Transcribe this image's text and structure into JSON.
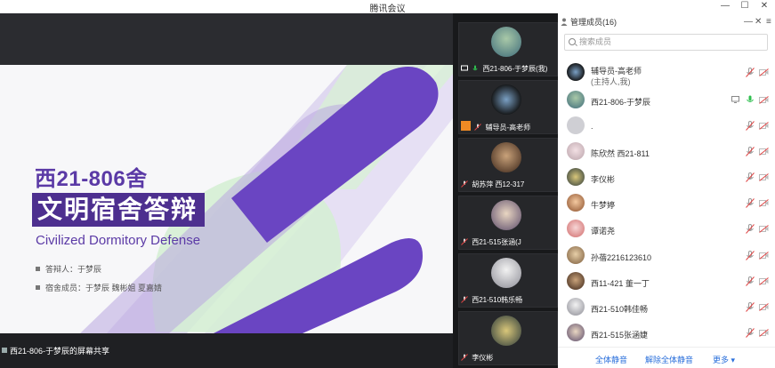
{
  "window": {
    "title": "腾讯会议",
    "min_label": "—",
    "max_label": "☐",
    "close_label": "✕"
  },
  "slide": {
    "title_line1": "西21-806舍",
    "title_line2": "文明宿舍答辩",
    "subtitle_en": "Civilized Dormitory Defense",
    "bullet1": "答辩人：于梦辰",
    "bullet2": "宿舍成员：于梦辰  魏彬姐  夏嘉婧"
  },
  "share_label": "西21-806-于梦辰的屏幕共享",
  "tiles": [
    {
      "label": "西21-806-于梦辰(我)"
    },
    {
      "label": "辅导员-高老师"
    },
    {
      "label": "胡苏萍 西12-317"
    },
    {
      "label": "西21-515张涵(J"
    },
    {
      "label": "西21-510韩乐畅"
    },
    {
      "label": "李仪彬"
    }
  ],
  "panel": {
    "title": "管理成员(16)",
    "search_placeholder": "搜索成员",
    "members": [
      {
        "name": "辅导员-高老师",
        "sub": "(主持人,我)"
      },
      {
        "name": "西21-806-于梦辰",
        "sub": ""
      },
      {
        "name": ".",
        "sub": ""
      },
      {
        "name": "陈欣然 西21-811",
        "sub": ""
      },
      {
        "name": "李仪彬",
        "sub": ""
      },
      {
        "name": "牛梦婷",
        "sub": ""
      },
      {
        "name": "谭诺尧",
        "sub": ""
      },
      {
        "name": "孙蓓2216123610",
        "sub": ""
      },
      {
        "name": "西11-421 董一丁",
        "sub": ""
      },
      {
        "name": "西21-510韩佳畅",
        "sub": ""
      },
      {
        "name": "西21-515张涵婕",
        "sub": ""
      }
    ],
    "footer": {
      "mute_all": "全体静音",
      "unmute_all": "解除全体静音",
      "more": "更多 ▾"
    }
  },
  "colors": {
    "brand_purple": "#4d2f8f",
    "link_blue": "#2a6fdb",
    "mic_on": "#2fbf4f",
    "muted_red": "#e04545"
  },
  "icons": [
    "person-icon",
    "search-icon",
    "mic-icon",
    "mic-muted-icon",
    "camera-off-icon",
    "screen-share-icon"
  ]
}
